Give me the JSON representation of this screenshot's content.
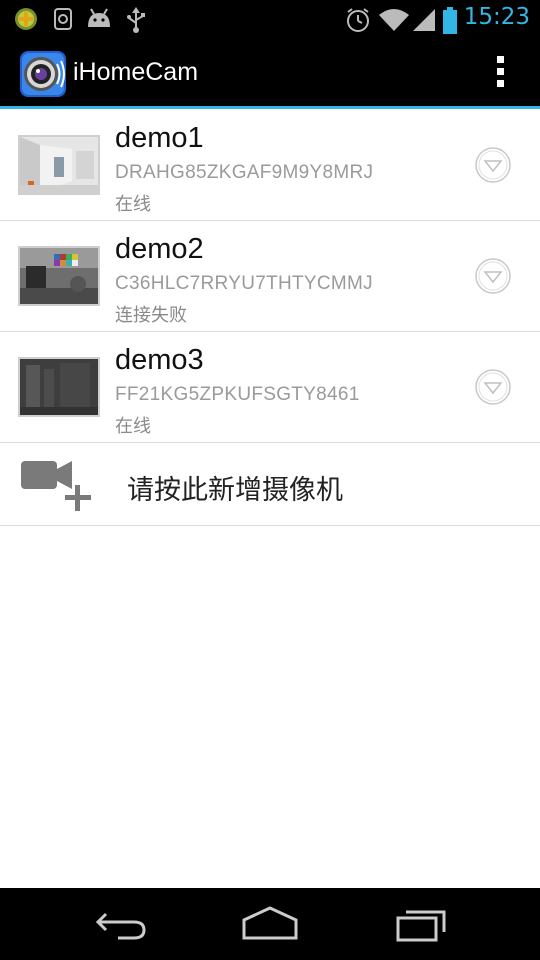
{
  "status_bar": {
    "time": "15:23",
    "icons": [
      "add-badge-icon",
      "sd-card-icon",
      "android-icon",
      "usb-icon",
      "alarm-icon",
      "wifi-icon",
      "signal-icon",
      "battery-icon"
    ]
  },
  "action_bar": {
    "title": "iHomeCam",
    "icons": [
      "app-logo-icon",
      "overflow-menu-icon"
    ]
  },
  "cameras": [
    {
      "name": "demo1",
      "uid": "DRAHG85ZKGAF9M9Y8MRJ",
      "status": "在线"
    },
    {
      "name": "demo2",
      "uid": "C36HLC7RRYU7THTYCMMJ",
      "status": "连接失败"
    },
    {
      "name": "demo3",
      "uid": "FF21KG5ZPKUFSGTY8461",
      "status": "在线"
    }
  ],
  "add_camera": {
    "label": "请按此新增摄像机"
  },
  "colors": {
    "accent": "#33b5e5",
    "background": "#ffffff",
    "bars": "#000000"
  }
}
